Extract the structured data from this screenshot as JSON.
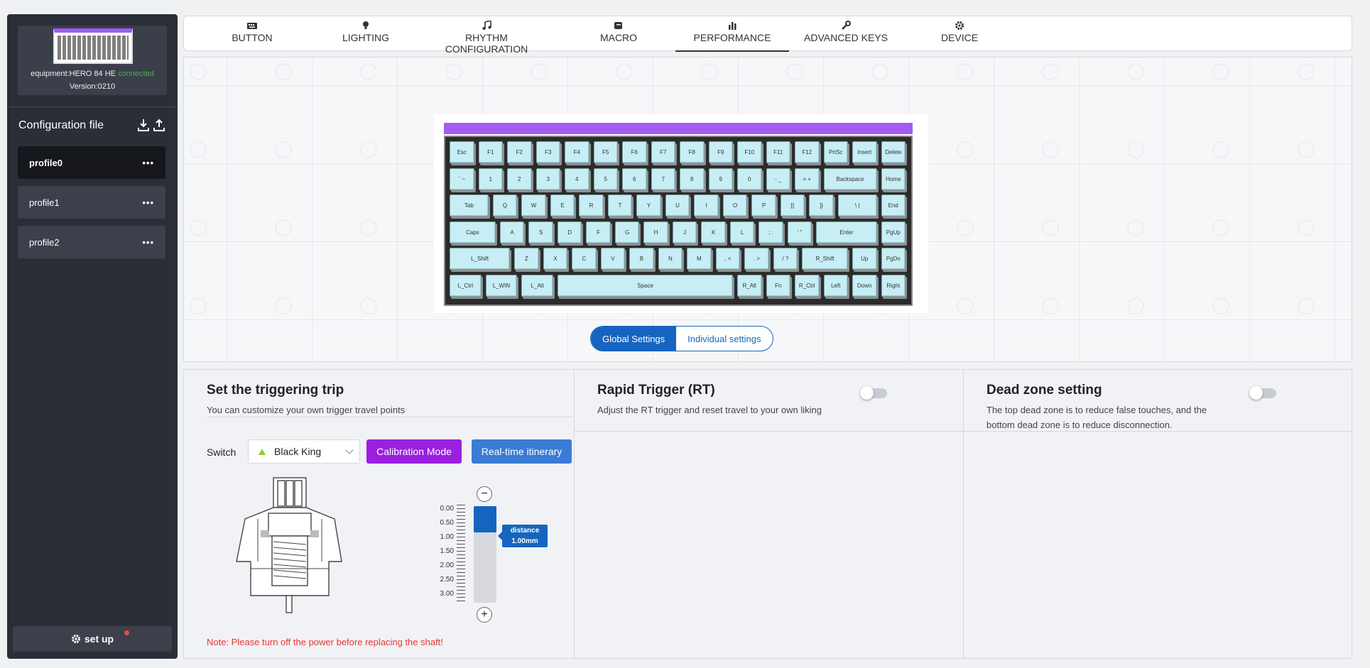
{
  "sidebar": {
    "device_label": "equipment:HERO 84 HE",
    "device_status": "connected",
    "version": "Version:0210",
    "config_title": "Configuration file",
    "download_icon": "download-icon",
    "upload_icon": "upload-icon",
    "profiles": [
      {
        "label": "profile0",
        "active": true
      },
      {
        "label": "profile1",
        "active": false
      },
      {
        "label": "profile2",
        "active": false
      }
    ],
    "more_label": "•••",
    "setup_label": "set up"
  },
  "tabs": [
    {
      "label": "BUTTON",
      "icon": "keyboard-icon"
    },
    {
      "label": "LIGHTING",
      "icon": "bulb-icon"
    },
    {
      "label": "RHYTHM CONFIGURATION",
      "icon": "music-icon"
    },
    {
      "label": "MACRO",
      "icon": "scroll-icon"
    },
    {
      "label": "PERFORMANCE",
      "icon": "bar-chart-icon",
      "active": true
    },
    {
      "label": "ADVANCED KEYS",
      "icon": "wrench-icon"
    },
    {
      "label": "DEVICE",
      "icon": "gear-icon"
    }
  ],
  "keyboard": {
    "accent": "#a45cf2",
    "rows": [
      [
        "Esc",
        "F1",
        "F2",
        "F3",
        "F4",
        "F5",
        "F6",
        "F7",
        "F8",
        "F9",
        "F10",
        "F11",
        "F12",
        "PrtSc",
        "Insert",
        "Delete"
      ],
      [
        "` ~",
        "1",
        "2",
        "3",
        "4",
        "5",
        "6",
        "7",
        "8",
        "9",
        "0",
        "- _",
        "= +",
        "Backspace",
        "Home"
      ],
      [
        "Tab",
        "Q",
        "W",
        "E",
        "R",
        "T",
        "Y",
        "U",
        "I",
        "O",
        "P",
        "[{",
        "]}",
        "\\ |",
        "End"
      ],
      [
        "Caps",
        "A",
        "S",
        "D",
        "F",
        "G",
        "H",
        "J",
        "K",
        "L",
        "; :",
        "' \"",
        "Enter",
        "PgUp"
      ],
      [
        "L_Shift",
        "Z",
        "X",
        "C",
        "V",
        "B",
        "N",
        "M",
        ", <",
        ". >",
        "/ ?",
        "R_Shift",
        "Up",
        "PgDn"
      ],
      [
        "L_Ctrl",
        "L_WIN",
        "L_Alt",
        "Space",
        "R_Alt",
        "Fn",
        "R_Ctrl",
        "Left",
        "Down",
        "Right"
      ]
    ]
  },
  "settings_toggle": {
    "global": "Global Settings",
    "individual": "Individual settings"
  },
  "trigger": {
    "title": "Set the triggering trip",
    "desc": "You can customize your own trigger travel points",
    "switch_label": "Switch",
    "switch_value": "Black King",
    "calibration_btn": "Calibration Mode",
    "realtime_btn": "Real-time itinerary",
    "scale": [
      "0.00",
      "0.50",
      "1.00",
      "1.50",
      "2.00",
      "2.50",
      "3.00"
    ],
    "minus": "−",
    "plus": "+",
    "distance_label": "distance",
    "distance_value": "1.00mm",
    "distance_fraction": 0.27,
    "note": "Note: Please turn off the power before replacing the shaft!"
  },
  "rapid_trigger": {
    "title": "Rapid Trigger (RT)",
    "desc": "Adjust the RT trigger and reset travel to your own liking",
    "enabled": false
  },
  "dead_zone": {
    "title": "Dead zone setting",
    "desc": "The top dead zone is to reduce false touches, and the bottom dead zone is to reduce disconnection.",
    "enabled": false
  }
}
